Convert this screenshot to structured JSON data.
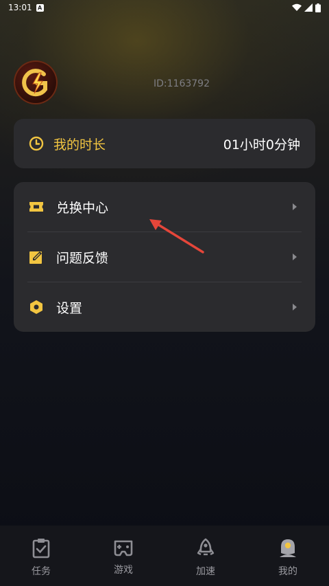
{
  "status_bar": {
    "time": "13:01",
    "badge": "A"
  },
  "profile": {
    "user_id": "ID:1163792"
  },
  "duration_card": {
    "label": "我的时长",
    "value": "01小时0分钟"
  },
  "menu": [
    {
      "label": "兑换中心",
      "icon": "ticket-icon"
    },
    {
      "label": "问题反馈",
      "icon": "feedback-icon"
    },
    {
      "label": "设置",
      "icon": "settings-hex-icon"
    }
  ],
  "bottom_nav": [
    {
      "label": "任务",
      "icon": "clipboard-check-icon"
    },
    {
      "label": "游戏",
      "icon": "gamepad-icon"
    },
    {
      "label": "加速",
      "icon": "rocket-icon"
    },
    {
      "label": "我的",
      "icon": "user-icon",
      "active": true
    }
  ],
  "colors": {
    "accent": "#f2c541",
    "card": "#2b2b2e",
    "annotation": "#e5463a"
  }
}
